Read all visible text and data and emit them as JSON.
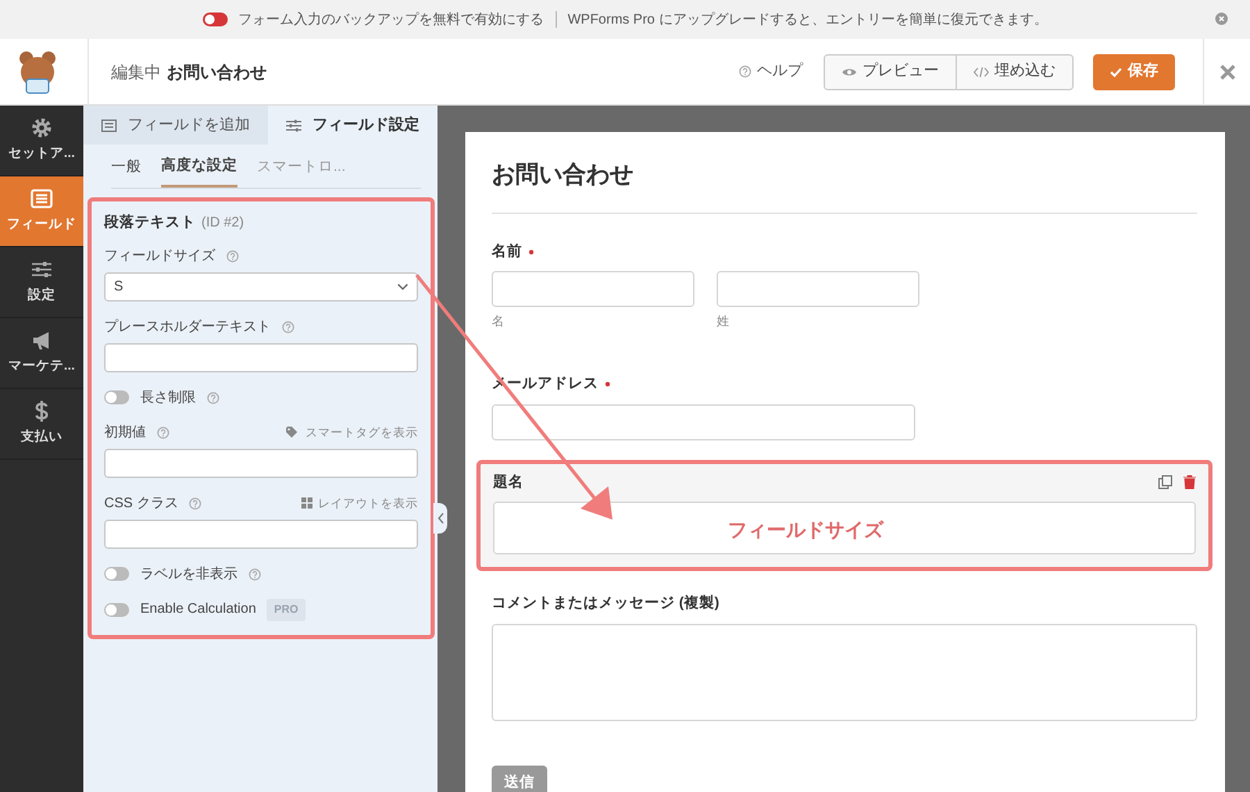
{
  "notice": {
    "primary": "フォーム入力のバックアップを無料で有効にする",
    "secondary": "WPForms Pro にアップグレードすると、エントリーを簡単に復元できます。"
  },
  "header": {
    "status": "編集中",
    "form_name": "お問い合わせ",
    "help": "ヘルプ",
    "buttons": [
      {
        "label": "プレビュー",
        "kind": "preview"
      },
      {
        "label": "埋め込む",
        "kind": "embed"
      },
      {
        "label": "保存",
        "kind": "save"
      }
    ]
  },
  "sidebar": {
    "items": [
      {
        "label": "セットア...",
        "kind": "setup",
        "selected": false
      },
      {
        "label": "フィールド",
        "kind": "fields",
        "selected": true
      },
      {
        "label": "設定",
        "kind": "settings",
        "selected": false
      },
      {
        "label": "マーケテ...",
        "kind": "marketing",
        "selected": false
      },
      {
        "label": "支払い",
        "kind": "payments",
        "selected": false
      }
    ]
  },
  "panel": {
    "tabs": [
      {
        "label": "フィールドを追加",
        "kind": "add",
        "selected": false
      },
      {
        "label": "フィールド設定",
        "kind": "options",
        "selected": true
      }
    ],
    "subtabs": [
      {
        "label": "一般",
        "selected": false,
        "disabled": false
      },
      {
        "label": "高度な設定",
        "selected": true,
        "disabled": false
      },
      {
        "label": "スマートロ...",
        "selected": false,
        "disabled": true
      }
    ],
    "field_settings": {
      "highlighted": true,
      "title": "段落テキスト",
      "id": "(ID #2)",
      "options": [
        {
          "kind": "select",
          "label": "フィールドサイズ",
          "help": true,
          "value": "S"
        },
        {
          "kind": "text",
          "label": "プレースホルダーテキスト",
          "help": true
        },
        {
          "kind": "toggle",
          "label": "長さ制限",
          "help": true,
          "on": false
        },
        {
          "kind": "text",
          "label": "初期値",
          "help": true,
          "link": {
            "text": "スマートタグを表示",
            "kind": "tag"
          }
        },
        {
          "kind": "text",
          "label": "CSS クラス",
          "help": true,
          "link": {
            "text": "レイアウトを表示",
            "kind": "layout"
          }
        },
        {
          "kind": "toggle",
          "label": "ラベルを非表示",
          "help": true,
          "on": false
        },
        {
          "kind": "toggle",
          "label": "Enable Calculation",
          "help": false,
          "on": false,
          "badge": "PRO"
        }
      ]
    }
  },
  "form": {
    "title": "お問い合わせ",
    "fields": [
      {
        "kind": "name",
        "label": "名前",
        "required": true,
        "highlighted": false,
        "sublabels": [
          "名",
          "姓"
        ]
      },
      {
        "kind": "email",
        "label": "メールアドレス",
        "required": true,
        "highlighted": false
      },
      {
        "kind": "text",
        "label": "題名",
        "required": false,
        "highlighted": true
      },
      {
        "kind": "textarea",
        "label": "コメントまたはメッセージ (複製)",
        "required": false,
        "highlighted": false
      }
    ],
    "submit": "送信"
  },
  "annotation": {
    "text": "フィールドサイズ"
  }
}
